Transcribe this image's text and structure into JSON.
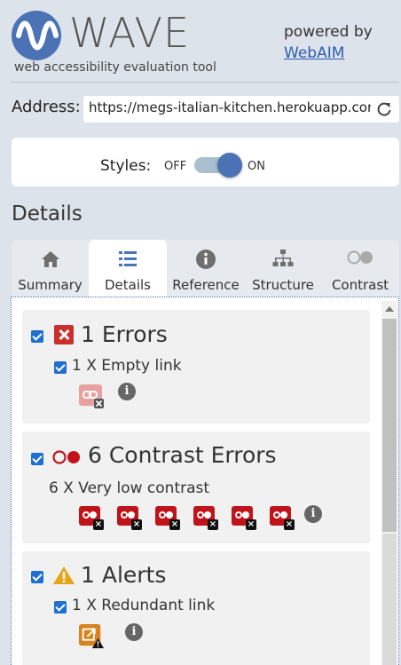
{
  "app": {
    "title": "WAVE",
    "tagline": "web accessibility evaluation tool",
    "powered_by": "powered by",
    "webaim_link": "WebAIM",
    "brand_color": "#4a72b5"
  },
  "address": {
    "label": "Address:",
    "value": "https://megs-italian-kitchen.herokuapp.com"
  },
  "styles": {
    "label": "Styles:",
    "off": "OFF",
    "on": "ON",
    "state": "on"
  },
  "details_heading": "Details",
  "tabs": [
    {
      "label": "Summary",
      "icon": "home-icon",
      "active": false
    },
    {
      "label": "Details",
      "icon": "list-icon",
      "active": true
    },
    {
      "label": "Reference",
      "icon": "info-circle-icon",
      "active": false
    },
    {
      "label": "Structure",
      "icon": "sitemap-icon",
      "active": false
    },
    {
      "label": "Contrast",
      "icon": "contrast-icon",
      "active": false
    }
  ],
  "groups": {
    "errors": {
      "count": "1",
      "title": "1 Errors",
      "item": "1 X Empty link",
      "icon_count": 1,
      "color": "#c9302c"
    },
    "contrast": {
      "title": "6 Contrast Errors",
      "item": "6 X Very low contrast",
      "icon_count": 6,
      "color": "#c0141a"
    },
    "alerts": {
      "title": "1 Alerts",
      "item": "1 X Redundant link",
      "icon_count": 1,
      "color": "#e8a317"
    }
  }
}
